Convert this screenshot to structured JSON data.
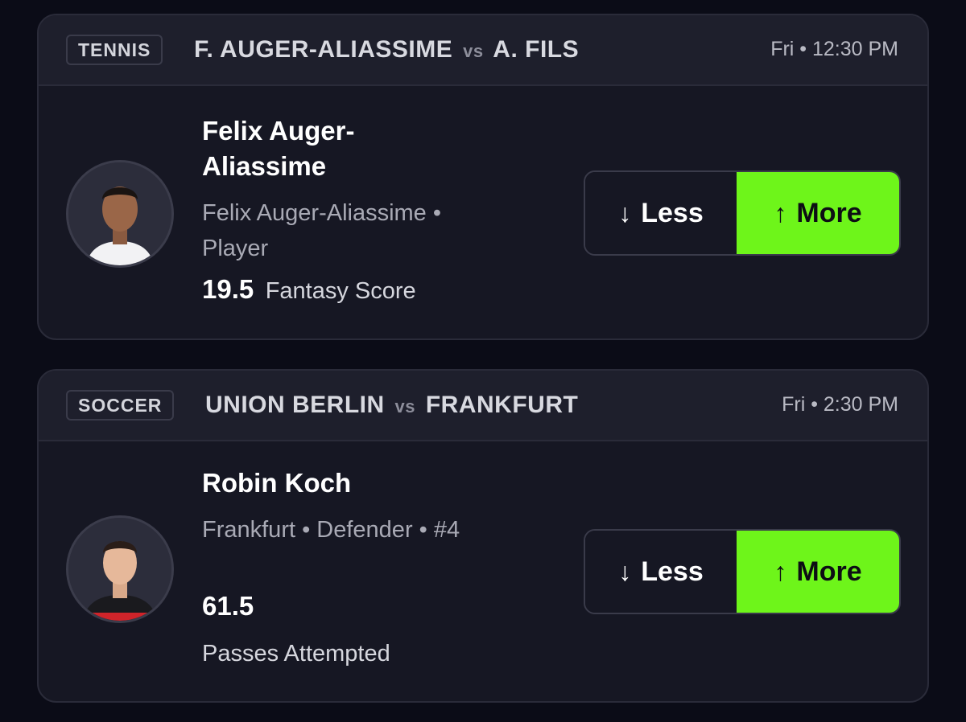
{
  "colors": {
    "background": "#0b0c17",
    "card": "#161723",
    "header": "#1e1f2c",
    "more_button": "#6ef51a"
  },
  "cards": [
    {
      "sport": "TENNIS",
      "team_a": "F. AUGER-ALIASSIME",
      "vs": "vs",
      "team_b": "A. FILS",
      "time": "Fri • 12:30 PM",
      "player_name": "Felix Auger-Aliassime",
      "player_detail": "Felix Auger-Aliassime • Player",
      "line": "19.5",
      "stat": "Fantasy Score",
      "less_label": "Less",
      "more_label": "More",
      "less_icon": "arrow-down-icon",
      "more_icon": "arrow-up-icon"
    },
    {
      "sport": "SOCCER",
      "team_a": "UNION BERLIN",
      "vs": "vs",
      "team_b": "FRANKFURT",
      "time": "Fri • 2:30 PM",
      "player_name": "Robin Koch",
      "player_detail": "Frankfurt • Defender • #4",
      "line": "61.5",
      "stat": "Passes Attempted",
      "less_label": "Less",
      "more_label": "More",
      "less_icon": "arrow-down-icon",
      "more_icon": "arrow-up-icon"
    }
  ]
}
